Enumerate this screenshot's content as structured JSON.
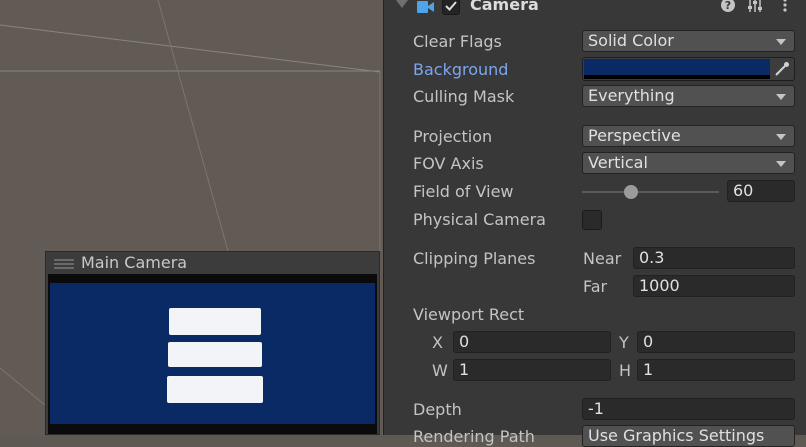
{
  "preview": {
    "title": "Main Camera"
  },
  "component": {
    "title": "Camera",
    "enabled": true
  },
  "fields": {
    "clear_flags": {
      "label": "Clear Flags",
      "value": "Solid Color"
    },
    "background": {
      "label": "Background",
      "color": "#0a2a66"
    },
    "culling_mask": {
      "label": "Culling Mask",
      "value": "Everything"
    },
    "projection": {
      "label": "Projection",
      "value": "Perspective"
    },
    "fov_axis": {
      "label": "FOV Axis",
      "value": "Vertical"
    },
    "field_of_view": {
      "label": "Field of View",
      "value": "60",
      "fraction": 0.36
    },
    "physical_camera": {
      "label": "Physical Camera",
      "checked": false
    },
    "clipping_planes": {
      "label": "Clipping Planes",
      "near_label": "Near",
      "near": "0.3",
      "far_label": "Far",
      "far": "1000"
    },
    "viewport_rect": {
      "label": "Viewport Rect",
      "x_label": "X",
      "x": "0",
      "y_label": "Y",
      "y": "0",
      "w_label": "W",
      "w": "1",
      "h_label": "H",
      "h": "1"
    },
    "depth": {
      "label": "Depth",
      "value": "-1"
    },
    "rendering_path": {
      "label": "Rendering Path",
      "value": "Use Graphics Settings"
    }
  },
  "icons": {
    "fold": "foldout-arrow-icon",
    "camera": "camera-component-icon",
    "help": "help-icon",
    "presets": "presets-icon",
    "menu": "kebab-menu-icon",
    "eyedropper": "eyedropper-icon"
  }
}
